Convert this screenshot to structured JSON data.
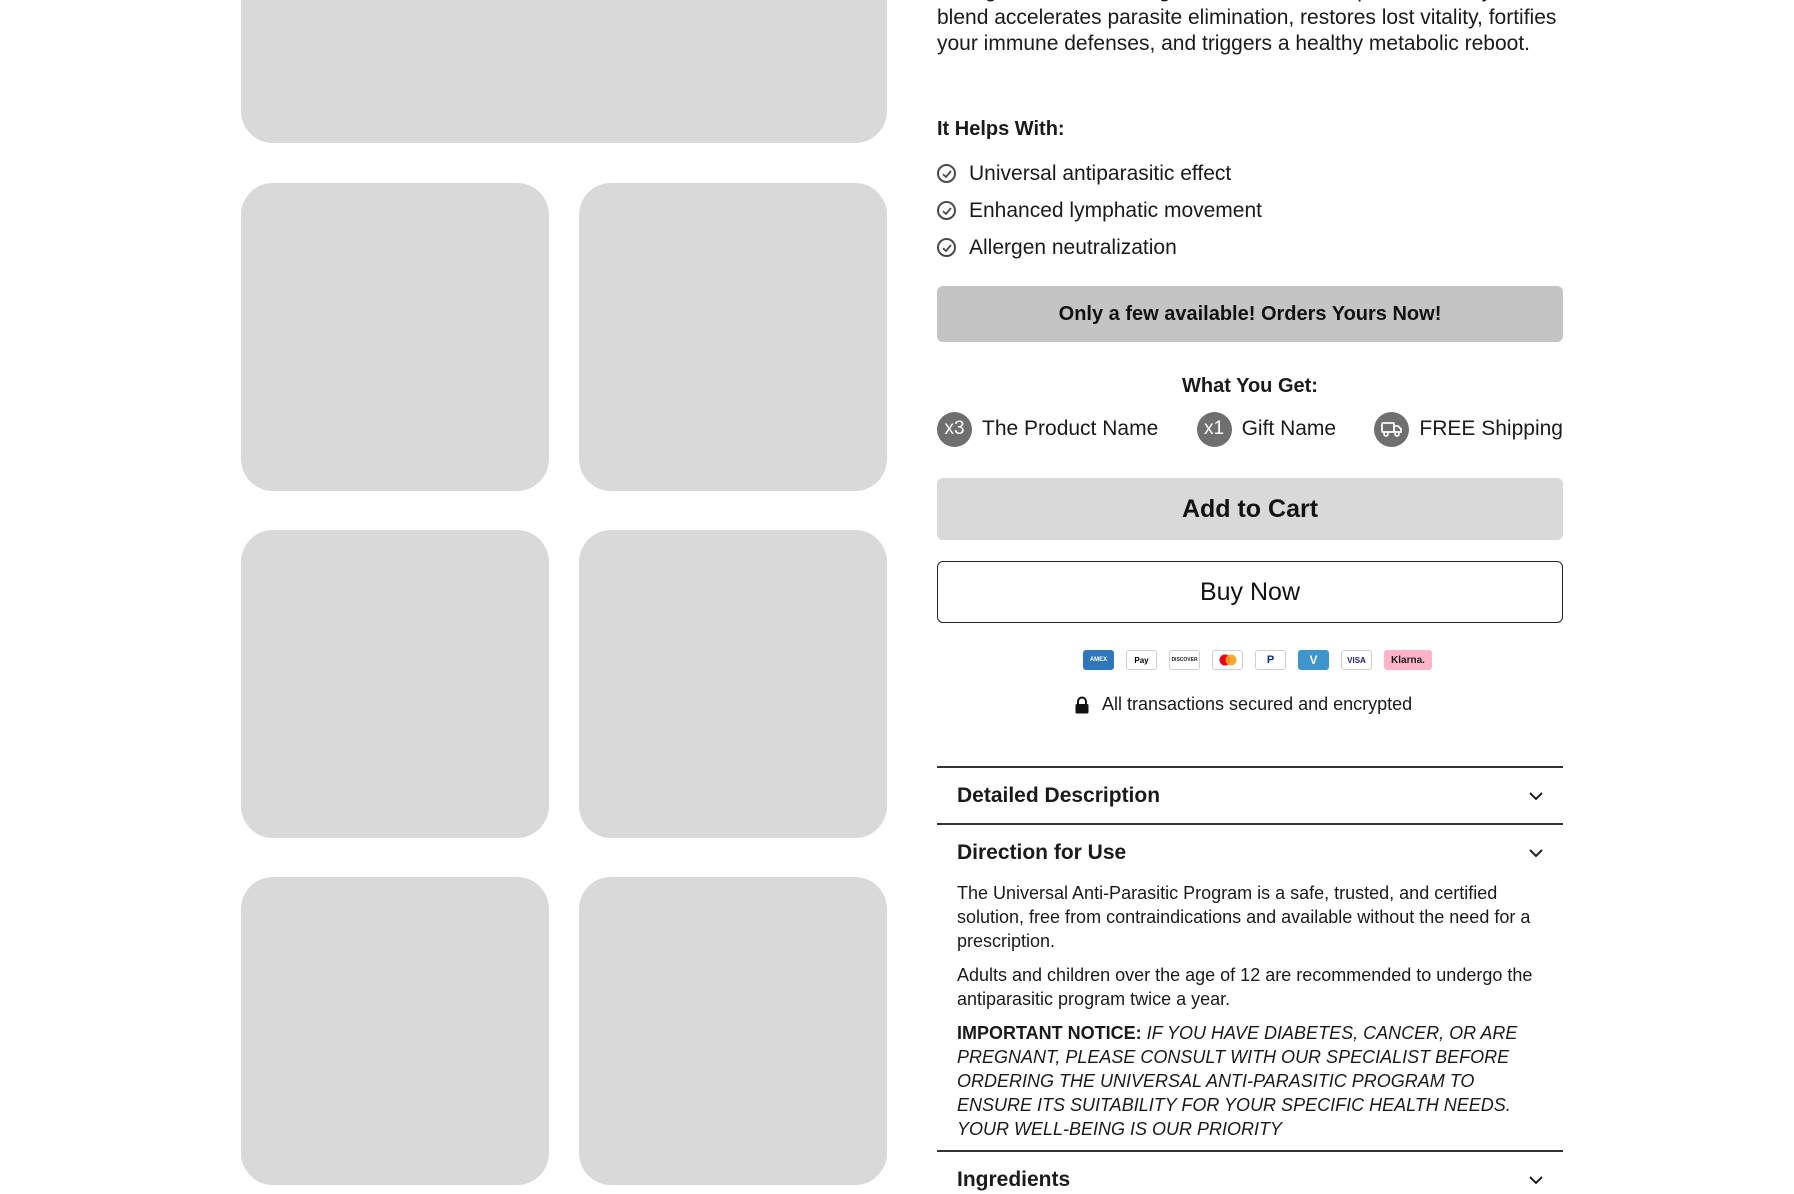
{
  "intro_text": "from germinated cereal grains and medicinal plants. This dynamic blend accelerates parasite elimination, restores lost vitality, fortifies your immune defenses, and triggers a healthy metabolic reboot.",
  "helps": {
    "title": "It Helps With:",
    "items": [
      "Universal antiparasitic effect",
      "Enhanced lymphatic movement",
      "Allergen neutralization"
    ]
  },
  "scarcity_label": "Only a few available! Orders Yours Now!",
  "what_you_get": {
    "title": "What You Get:",
    "items": [
      {
        "badge": "x3",
        "label": "The Product Name"
      },
      {
        "badge": "x1",
        "label": "Gift Name"
      },
      {
        "badge_icon": "truck-icon",
        "label": "FREE Shipping"
      }
    ]
  },
  "buttons": {
    "add_to_cart": "Add to Cart",
    "buy_now": "Buy Now"
  },
  "payment_methods": [
    {
      "icon": "amex-icon",
      "label": "AMEX"
    },
    {
      "icon": "apple-pay-icon",
      "label": "Pay"
    },
    {
      "icon": "discover-icon",
      "label": "DISCOVER"
    },
    {
      "icon": "mastercard-icon",
      "label": ""
    },
    {
      "icon": "paypal-icon",
      "label": "P"
    },
    {
      "icon": "venmo-icon",
      "label": "V"
    },
    {
      "icon": "visa-icon",
      "label": "VISA"
    },
    {
      "icon": "klarna-icon",
      "label": "Klarna."
    }
  ],
  "secure_text": "All transactions secured and encrypted",
  "accordion": {
    "detailed_description": "Detailed Description",
    "direction_for_use": {
      "title": "Direction for Use",
      "p1": "The Universal Anti-Parasitic Program is a safe, trusted, and certified solution, free from contraindications and available without the need for a prescription.",
      "p2": "Adults and children over the age of 12 are recommended to undergo the antiparasitic program twice a year.",
      "notice_label": "IMPORTANT NOTICE:",
      "notice_text": "IF YOU HAVE DIABETES, CANCER, OR ARE PREGNANT, PLEASE CONSULT WITH OUR SPECIALIST BEFORE ORDERING THE UNIVERSAL ANTI-PARASITIC PROGRAM TO ENSURE ITS SUITABILITY FOR YOUR SPECIFIC HEALTH NEEDS. YOUR WELL-BEING IS OUR PRIORITY"
    },
    "ingredients": "Ingredients"
  },
  "colors": {
    "placeholder": "#d9d9d9",
    "scarcity_bg": "#c4c4c4",
    "badge_bg": "#6f6f6f",
    "klarna": "#ffb3c7"
  }
}
